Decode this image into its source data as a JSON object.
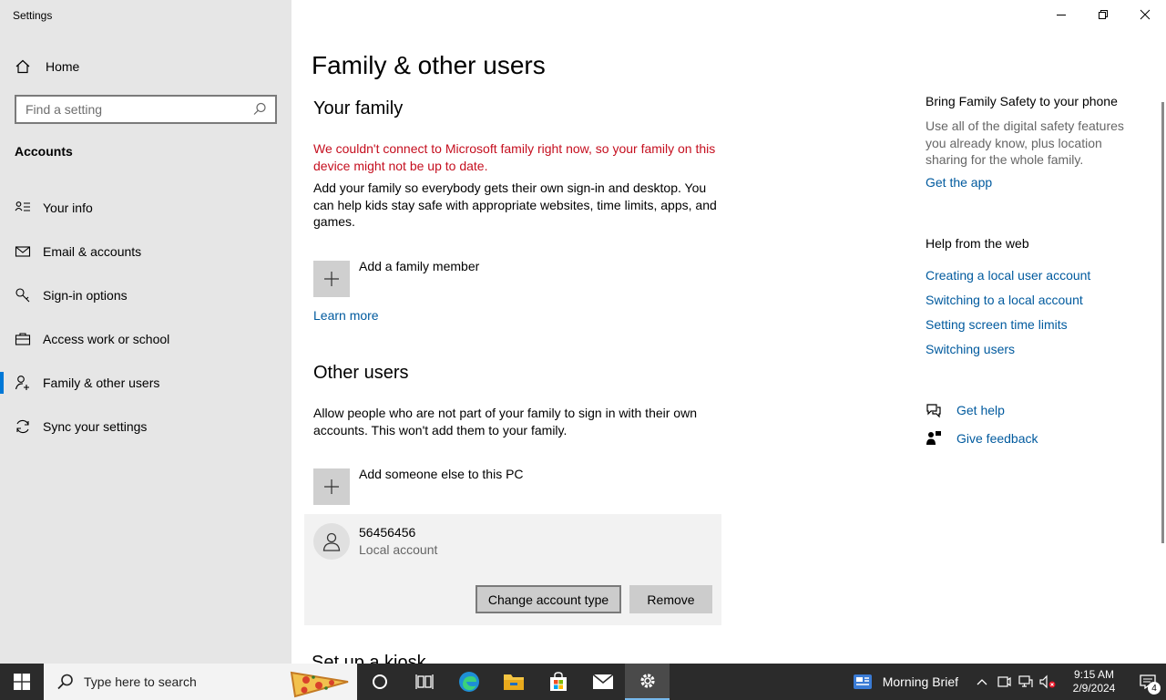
{
  "window": {
    "title": "Settings",
    "controls": [
      "minimize",
      "restore",
      "close"
    ]
  },
  "sidebar": {
    "home_label": "Home",
    "search_placeholder": "Find a setting",
    "section": "Accounts",
    "items": [
      {
        "label": "Your info",
        "icon": "person-card-icon"
      },
      {
        "label": "Email & accounts",
        "icon": "envelope-icon"
      },
      {
        "label": "Sign-in options",
        "icon": "key-icon"
      },
      {
        "label": "Access work or school",
        "icon": "briefcase-icon"
      },
      {
        "label": "Family & other users",
        "icon": "add-person-icon",
        "active": true
      },
      {
        "label": "Sync your settings",
        "icon": "sync-icon"
      }
    ]
  },
  "main": {
    "title": "Family & other users",
    "family": {
      "heading": "Your family",
      "warning": "We couldn't connect to Microsoft family right now, so your family on this device might not be up to date.",
      "description": "Add your family so everybody gets their own sign-in and desktop. You can help kids stay safe with appropriate websites, time limits, apps, and games.",
      "add_label": "Add a family member",
      "learn_more": "Learn more"
    },
    "other_users": {
      "heading": "Other users",
      "description": "Allow people who are not part of your family to sign in with their own accounts. This won't add them to your family.",
      "add_label": "Add someone else to this PC",
      "user": {
        "name": "56456456",
        "type": "Local account",
        "change_button": "Change account type",
        "remove_button": "Remove"
      }
    },
    "next_heading_partial": "Set up a kiosk"
  },
  "right": {
    "promo_title": "Bring Family Safety to your phone",
    "promo_text": "Use all of the digital safety features you already know, plus location sharing for the whole family.",
    "promo_link": "Get the app",
    "help_title": "Help from the web",
    "help_links": [
      "Creating a local user account",
      "Switching to a local account",
      "Setting screen time limits",
      "Switching users"
    ],
    "get_help": "Get help",
    "give_feedback": "Give feedback"
  },
  "taskbar": {
    "search_text": "Type here to search",
    "apps": [
      "cortana-icon",
      "task-view-icon",
      "edge-icon",
      "file-explorer-icon",
      "store-icon",
      "mail-icon",
      "settings-icon"
    ],
    "news_label": "Morning Brief",
    "time": "9:15 AM",
    "date": "2/9/2024",
    "notification_count": "4"
  }
}
